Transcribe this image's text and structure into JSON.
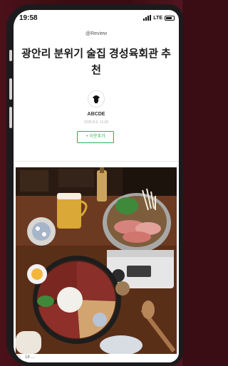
{
  "status_bar": {
    "time": "19:58",
    "network": "LTE",
    "icons": [
      "signal-icon",
      "battery-icon"
    ]
  },
  "post": {
    "category": "@Review",
    "title": "광안리 분위기 술집 경성육회관 추천",
    "author": "ABCDE",
    "date": "2025.8.6. 11:00",
    "neighbor_button": "+ 이웃추가"
  },
  "photo": {
    "subject": "food-table-photo"
  },
  "bottom_bar": {
    "icon": "comment-icon",
    "text": "18 ..."
  },
  "colors": {
    "background": "#3a0d14",
    "phone_frame": "#1b1b1d",
    "accent_green": "#2fb14f"
  }
}
